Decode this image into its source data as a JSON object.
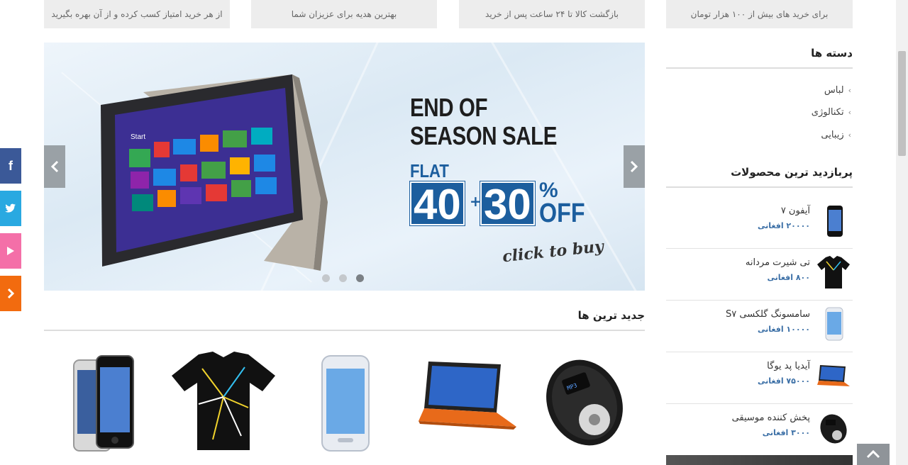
{
  "features": [
    {
      "text": "از هر خرید امتیاز کسب کرده و از آن بهره بگیرید"
    },
    {
      "text": "بهترین هدیه برای عزیزان شما"
    },
    {
      "text": "بازگشت کالا تا ۲۴ ساعت پس از خرید"
    },
    {
      "text": "برای خرید های بیش از ۱۰۰ هزار تومان"
    }
  ],
  "slider": {
    "line1": "END OF",
    "line2": "SEASON SALE",
    "flat": "FLAT",
    "num1": "40",
    "plus": "+",
    "num2": "30",
    "pct": "%",
    "off": "OFF",
    "cta": "click to buy",
    "slide_count": 3,
    "active_slide": 3
  },
  "newest": {
    "title": "جدید ترین ها",
    "products": [
      {
        "name": "music-player",
        "icon": "music-player-image"
      },
      {
        "name": "laptop",
        "icon": "laptop-image"
      },
      {
        "name": "galaxy-phone",
        "icon": "phone-image"
      },
      {
        "name": "tshirt",
        "icon": "tshirt-image"
      },
      {
        "name": "iphone",
        "icon": "iphone-image"
      }
    ]
  },
  "sidebar": {
    "categories_title": "دسته ها",
    "categories": [
      {
        "label": "لباس"
      },
      {
        "label": "تکنالوژی"
      },
      {
        "label": "زیبایی"
      }
    ],
    "popular_title": "پربازدید ترین محصولات",
    "popular": [
      {
        "name": "آیفون ۷",
        "price": "۲۰۰۰۰ افغانی"
      },
      {
        "name": "تی شیرت مردانه",
        "price": "۸۰۰ افغانی"
      },
      {
        "name": "سامسونگ گلکسی S۷",
        "price": "۱۰۰۰۰ افغانی"
      },
      {
        "name": "آیدیا پد یوگا",
        "price": "۷۵۰۰۰ افغانی"
      },
      {
        "name": "پخش کننده موسیقی",
        "price": "۳۰۰۰ افغانی"
      }
    ]
  },
  "social": [
    {
      "name": "facebook",
      "color": "#3b5998"
    },
    {
      "name": "twitter",
      "color": "#29a9e1"
    },
    {
      "name": "youtube",
      "color": "#f46fa8"
    },
    {
      "name": "more",
      "color": "#f26b0f"
    }
  ],
  "colors": {
    "accent_blue": "#1c5e9e",
    "price_blue": "#3b6fa6"
  }
}
